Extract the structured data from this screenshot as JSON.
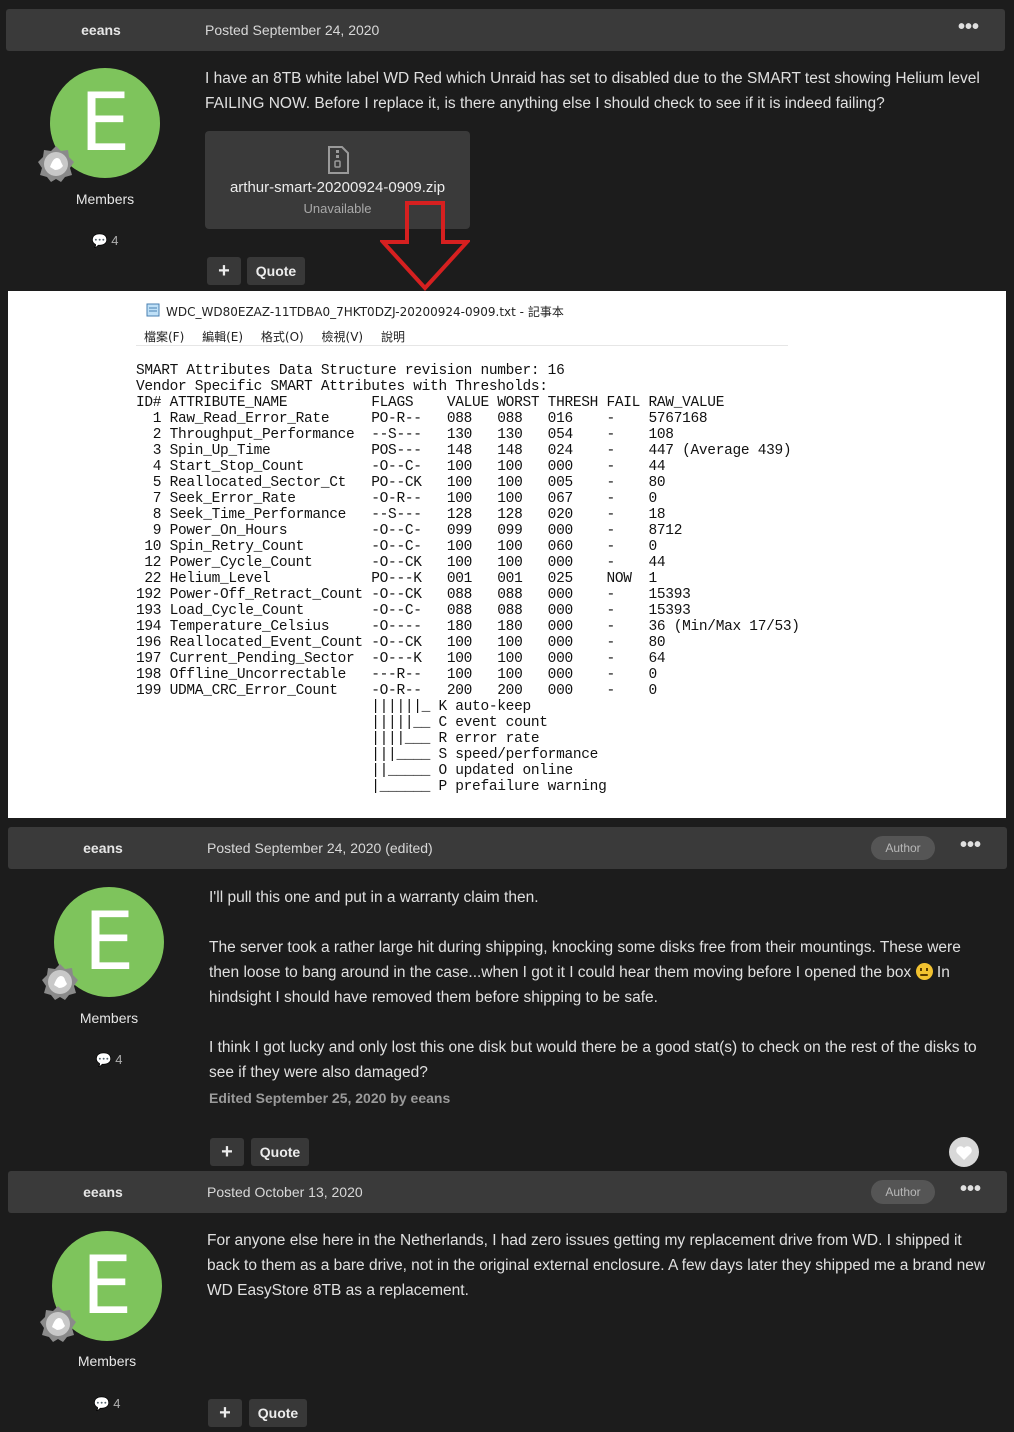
{
  "posts": [
    {
      "author": "eeans",
      "date": "Posted September 24, 2020",
      "role": "Members",
      "post_count": "4",
      "avatar_letter": "E",
      "body": [
        "I have an 8TB white label WD Red which Unraid has set to disabled due to the SMART test showing Helium level FAILING NOW. Before I replace it, is there anything else I should check to see if it is indeed failing?"
      ],
      "attachment": {
        "name": "arthur-smart-20200924-0909.zip",
        "status": "Unavailable"
      },
      "quote_label": "Quote",
      "plus_label": "+"
    },
    {
      "author": "eeans",
      "date": "Posted September 24, 2020 (edited)",
      "badge": "Author",
      "role": "Members",
      "post_count": "4",
      "avatar_letter": "E",
      "body": [
        "I'll pull this one and put in a warranty claim then.",
        "The server took a rather large hit during shipping, knocking some disks free from their mountings. These were then loose to bang around in the case...when I got it I could hear them moving before I opened the box",
        "In hindsight I should have removed them before shipping to be safe.",
        "I think I got lucky and only lost this one disk but would there be a good stat(s) to check on the rest of the disks to see if they were also damaged?"
      ],
      "edited": "Edited September 25, 2020 by eeans",
      "quote_label": "Quote",
      "plus_label": "+"
    },
    {
      "author": "eeans",
      "date": "Posted October 13, 2020",
      "badge": "Author",
      "role": "Members",
      "post_count": "4",
      "avatar_letter": "E",
      "body": [
        "For anyone else here in the Netherlands, I had zero issues getting my replacement drive from WD. I shipped it back to them as a bare drive, not in the original external enclosure. A few days later they shipped me a brand new WD EasyStore 8TB as a replacement."
      ],
      "quote_label": "Quote",
      "plus_label": "+"
    }
  ],
  "more_label": "•••",
  "notepad": {
    "title": "WDC_WD80EZAZ-11TDBA0_7HKT0DZJ-20200924-0909.txt - 記事本",
    "menu": [
      "檔案(F)",
      "編輯(E)",
      "格式(O)",
      "檢視(V)",
      "說明"
    ],
    "lines": [
      "SMART Attributes Data Structure revision number: 16",
      "Vendor Specific SMART Attributes with Thresholds:",
      "ID# ATTRIBUTE_NAME          FLAGS    VALUE WORST THRESH FAIL RAW_VALUE",
      "  1 Raw_Read_Error_Rate     PO-R--   088   088   016    -    5767168",
      "  2 Throughput_Performance  --S---   130   130   054    -    108",
      "  3 Spin_Up_Time            POS---   148   148   024    -    447 (Average 439)",
      "  4 Start_Stop_Count        -O--C-   100   100   000    -    44",
      "  5 Reallocated_Sector_Ct   PO--CK   100   100   005    -    80",
      "  7 Seek_Error_Rate         -O-R--   100   100   067    -    0",
      "  8 Seek_Time_Performance   --S---   128   128   020    -    18",
      "  9 Power_On_Hours          -O--C-   099   099   000    -    8712",
      " 10 Spin_Retry_Count        -O--C-   100   100   060    -    0",
      " 12 Power_Cycle_Count       -O--CK   100   100   000    -    44",
      " 22 Helium_Level            PO---K   001   001   025    NOW  1",
      "192 Power-Off_Retract_Count -O--CK   088   088   000    -    15393",
      "193 Load_Cycle_Count        -O--C-   088   088   000    -    15393",
      "194 Temperature_Celsius     -O----   180   180   000    -    36 (Min/Max 17/53)",
      "196 Reallocated_Event_Count -O--CK   100   100   000    -    80",
      "197 Current_Pending_Sector  -O---K   100   100   000    -    64",
      "198 Offline_Uncorrectable   ---R--   100   100   000    -    0",
      "199 UDMA_CRC_Error_Count    -O-R--   200   200   000    -    0",
      "                            ||||||_ K auto-keep",
      "                            |||||__ C event count",
      "                            ||||___ R error rate",
      "                            |||____ S speed/performance",
      "                            ||_____ O updated online",
      "                            |______ P prefailure warning"
    ]
  },
  "colors": {
    "avatar": "#7ec45c",
    "arrow": "#d62020",
    "header": "#3a3a3a"
  }
}
